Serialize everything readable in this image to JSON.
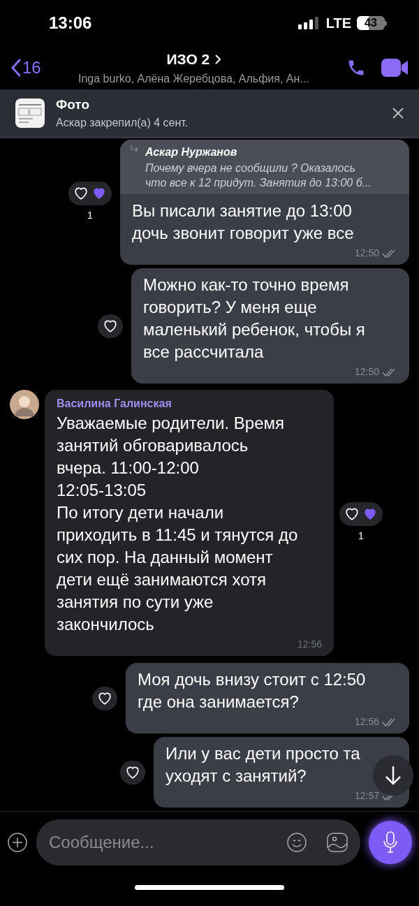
{
  "status_bar": {
    "time": "13:06",
    "network": "LTE",
    "battery": "43"
  },
  "header": {
    "back_count": "16",
    "title": "ИЗО 2",
    "subtitle": "Inga burko, Алёна Жеребцова, Альфия, Ан..."
  },
  "pinned": {
    "title": "Фото",
    "subtitle": "Аскар закрепил(а) 4 сент."
  },
  "messages": [
    {
      "kind": "outgoing",
      "reply": {
        "author": "Аскар Нуржанов",
        "lines": [
          "Почему вчера не сообщили ? Оказалось",
          "что все к 12 придут. Занятия до 13:00 б..."
        ]
      },
      "lines": [
        "Вы писали занятие до 13:00",
        "дочь звонит говорит уже все"
      ],
      "time": "12:50",
      "read": true,
      "liked": true,
      "like_count": "1"
    },
    {
      "kind": "outgoing",
      "lines": [
        "Можно как-то точно время",
        "говорить? У меня еще",
        "маленький ребенок, чтобы я",
        "все рассчитала"
      ],
      "time": "12:50",
      "read": true,
      "liked": false
    },
    {
      "kind": "incoming",
      "author": "Василина Галинская",
      "lines": [
        "Уважаемые родители. Время",
        "занятий обговаривалось",
        "вчера. 11:00-12:00",
        "12:05-13:05",
        "По итогу дети начали",
        "приходить в 11:45 и тянутся до",
        "сих пор. На данный момент",
        "дети ещё занимаются хотя",
        "занятия по сути уже",
        "закончилось"
      ],
      "time": "12:56",
      "liked": true,
      "like_count": "1"
    },
    {
      "kind": "outgoing",
      "lines": [
        "Моя дочь внизу стоит с 12:50",
        "где она занимается?"
      ],
      "time": "12:56",
      "read": true,
      "liked": false
    },
    {
      "kind": "outgoing",
      "lines": [
        "Или у вас дети просто та",
        "уходят с занятий?"
      ],
      "time": "12:57",
      "read": true,
      "liked": false
    }
  ],
  "composer": {
    "placeholder": "Сообщение..."
  }
}
